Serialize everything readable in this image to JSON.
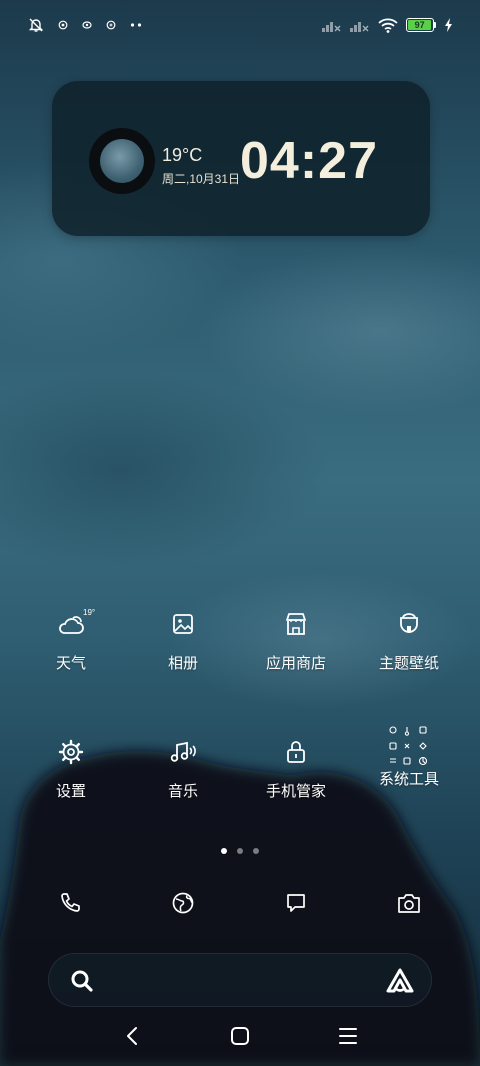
{
  "status_bar": {
    "battery_level": "97",
    "battery_fraction": 0.97,
    "icons": [
      "mute-bell-icon",
      "notification-icon-1",
      "notification-icon-2",
      "notification-icon-3",
      "more-dots-icon",
      "signal-1-icon",
      "signal-2-icon",
      "wifi-icon",
      "battery-icon",
      "charging-icon"
    ]
  },
  "widget": {
    "temperature": "19°C",
    "date": "周二,10月31日",
    "time": "04:27"
  },
  "apps": [
    {
      "label": "天气",
      "icon": "weather-icon",
      "badge": "19°"
    },
    {
      "label": "相册",
      "icon": "gallery-icon"
    },
    {
      "label": "应用商店",
      "icon": "app-store-icon"
    },
    {
      "label": "主题壁纸",
      "icon": "themes-icon"
    },
    {
      "label": "设置",
      "icon": "settings-gear-icon"
    },
    {
      "label": "音乐",
      "icon": "music-icon"
    },
    {
      "label": "手机管家",
      "icon": "security-lock-icon"
    },
    {
      "label": "系统工具",
      "icon": "system-tools-folder-icon"
    }
  ],
  "pager": {
    "pages": 3,
    "active": 1
  },
  "dock": [
    "phone-icon",
    "browser-icon",
    "messages-icon",
    "camera-icon"
  ],
  "search": {
    "icon": "search-icon",
    "assistant": "assistant-icon"
  },
  "nav": [
    "back-icon",
    "home-icon",
    "recents-icon"
  ]
}
